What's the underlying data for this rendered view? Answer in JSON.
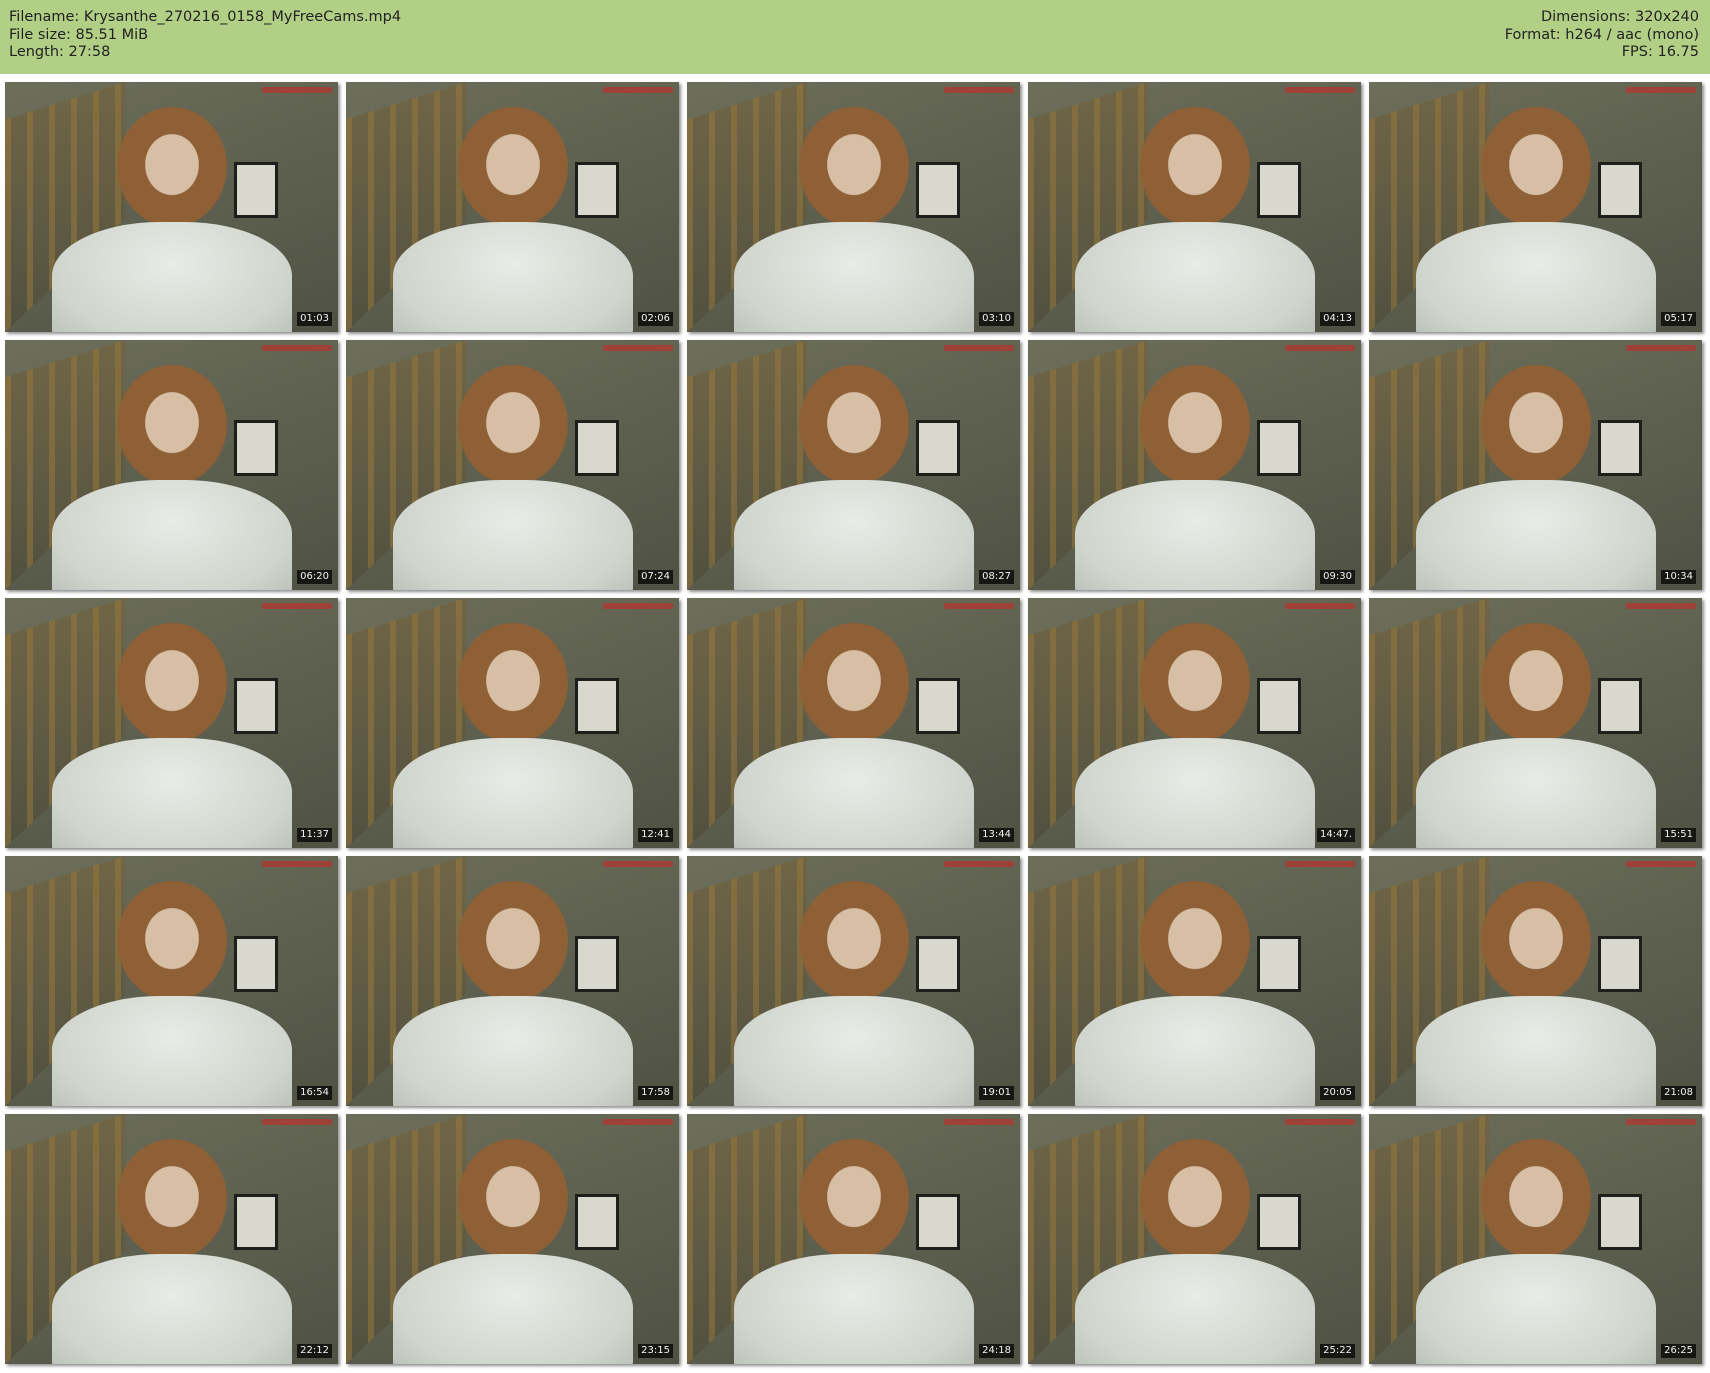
{
  "header": {
    "filename": "Filename: Krysanthe_270216_0158_MyFreeCams.mp4",
    "file_size": "File size: 85.51 MiB",
    "length": "Length: 27:58",
    "dimensions": "Dimensions: 320x240",
    "format": "Format: h264 / aac (mono)",
    "fps": "FPS: 16.75"
  },
  "thumbnails": [
    "01:03",
    "02:06",
    "03:10",
    "04:13",
    "05:17",
    "06:20",
    "07:24",
    "08:27",
    "09:30",
    "10:34",
    "11:37",
    "12:41",
    "13:44",
    "14:47.",
    "15:51",
    "16:54",
    "17:58",
    "19:01",
    "20:05",
    "21:08",
    "22:12",
    "23:15",
    "24:18",
    "25:22",
    "26:25"
  ],
  "colors": {
    "header_bg": "#b2cf86"
  }
}
